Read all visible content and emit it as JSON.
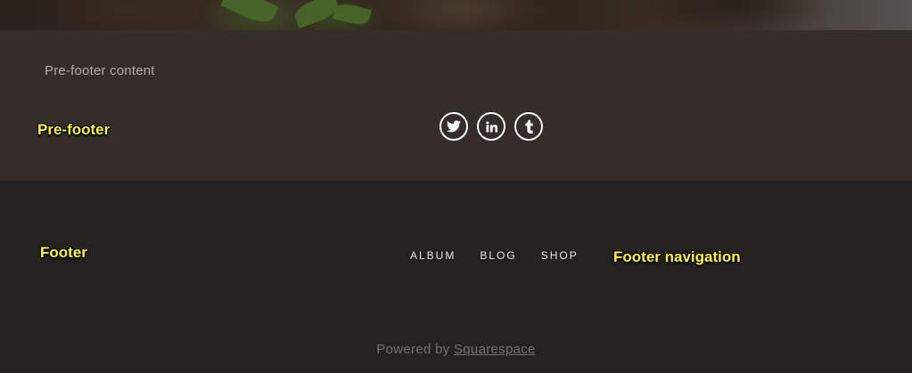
{
  "prefooter": {
    "content_text": "Pre-footer content",
    "social_links": [
      {
        "name": "twitter",
        "icon": "twitter-icon"
      },
      {
        "name": "linkedin",
        "icon": "linkedin-icon"
      },
      {
        "name": "tumblr",
        "icon": "tumblr-icon"
      }
    ]
  },
  "footer": {
    "nav": [
      {
        "label": "ALBUM"
      },
      {
        "label": "BLOG"
      },
      {
        "label": "SHOP"
      }
    ],
    "powered_prefix": "Powered by",
    "powered_link": "Squarespace"
  },
  "annotations": {
    "prefooter": "Pre-footer",
    "footer": "Footer",
    "footer_navigation": "Footer navigation"
  },
  "colors": {
    "prefooter_bg": "#342d2a",
    "footer_bg": "#252120",
    "annotation": "#ffff33"
  }
}
